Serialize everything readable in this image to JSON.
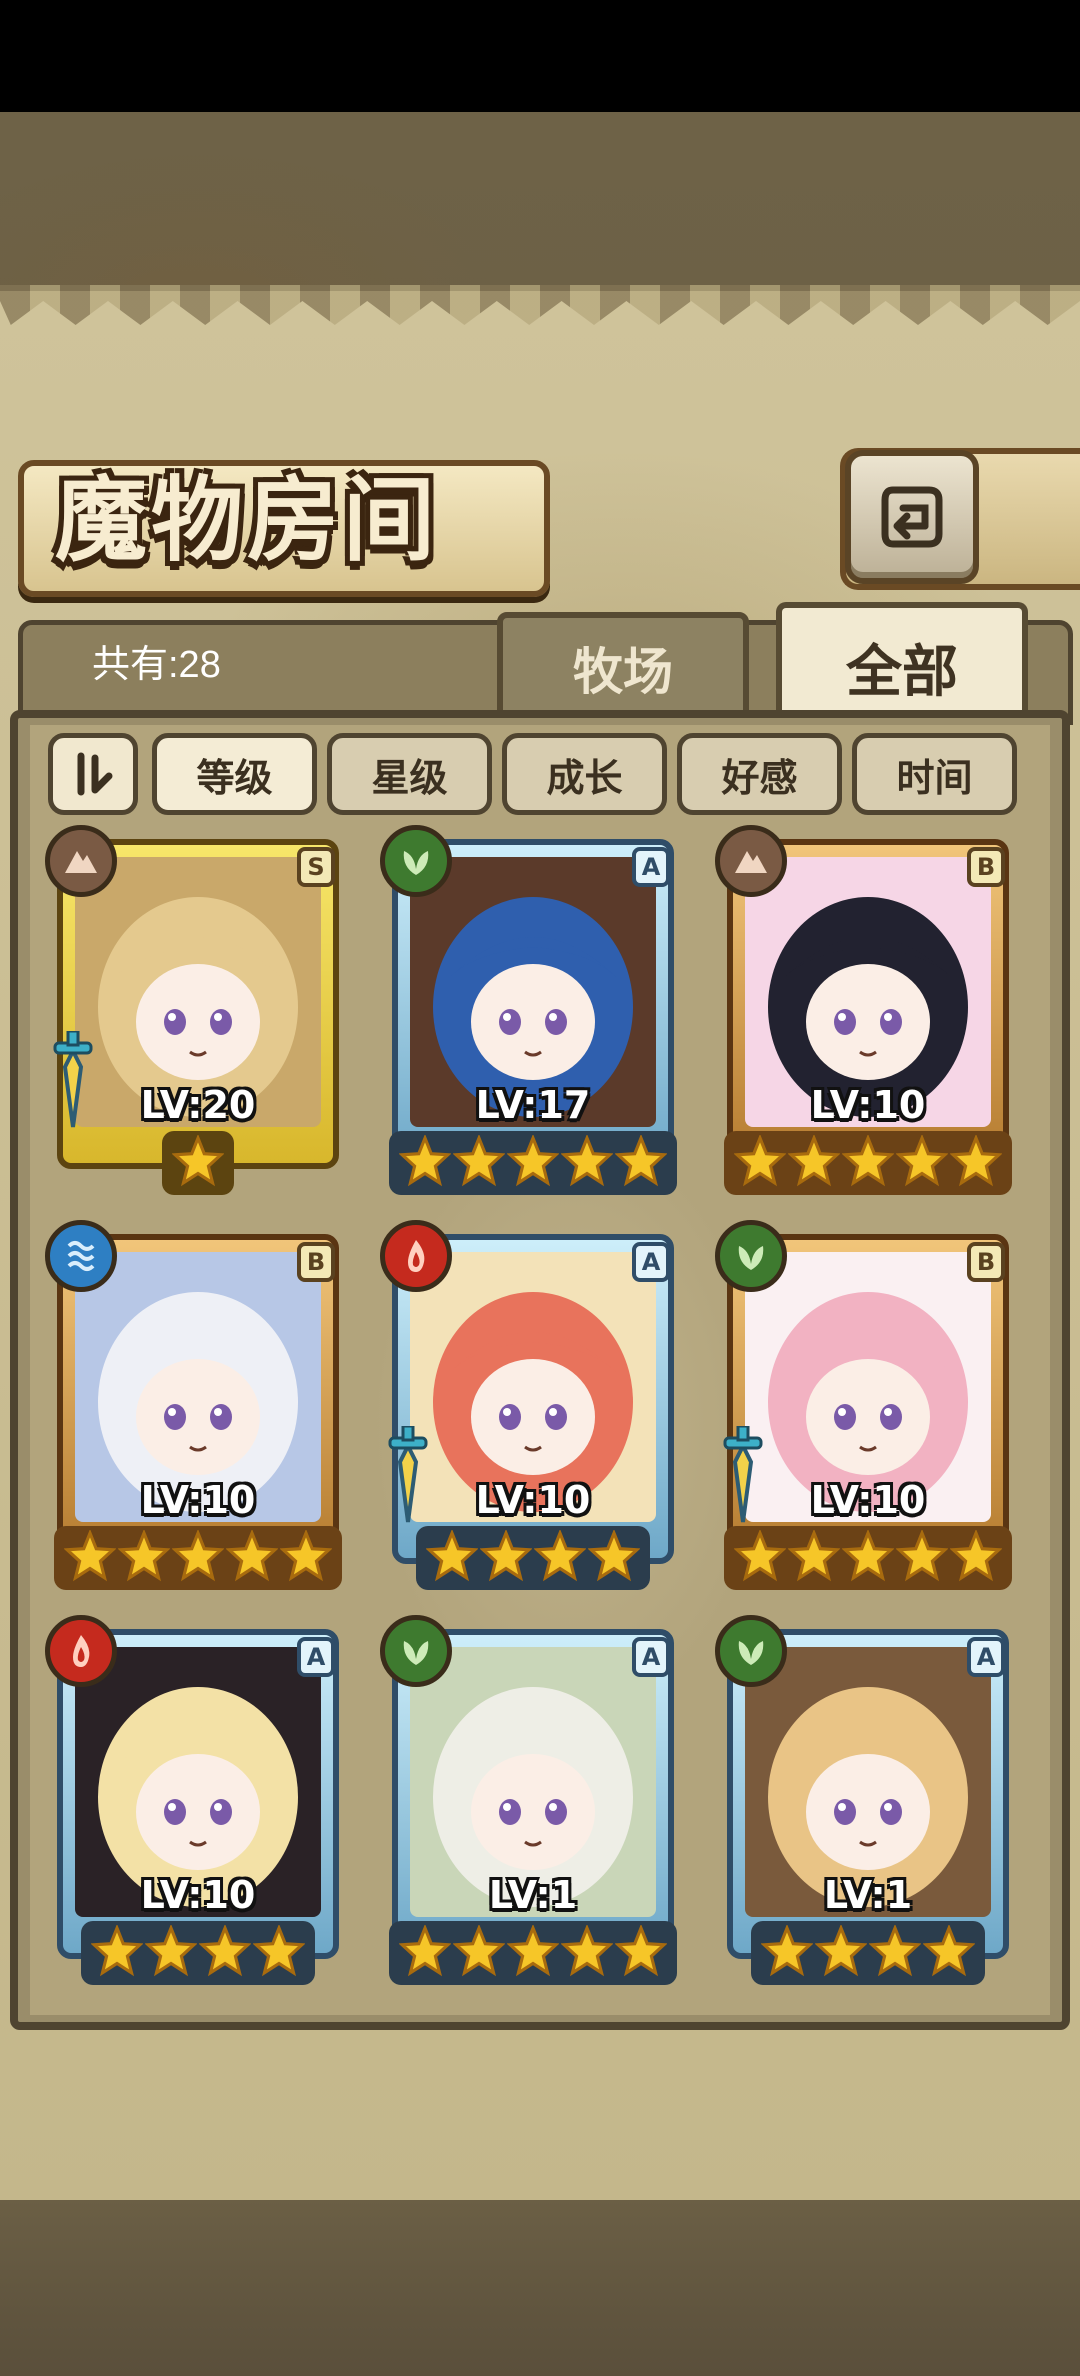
{
  "header": {
    "title": "魔物房间"
  },
  "summary": {
    "count_text": "共有:28"
  },
  "tabs": [
    {
      "label": "牧场",
      "active": false
    },
    {
      "label": "全部",
      "active": true
    }
  ],
  "sort": {
    "toggle_icon": "sort-order-icon",
    "options": [
      {
        "label": "等级",
        "active": true
      },
      {
        "label": "星级",
        "active": false
      },
      {
        "label": "成长",
        "active": false
      },
      {
        "label": "好感",
        "active": false
      },
      {
        "label": "时间",
        "active": false
      }
    ]
  },
  "monsters": [
    {
      "rank": "S",
      "level": "LV:20",
      "stars": 1,
      "element": "earth",
      "equipped": true,
      "colors": [
        "#e4c98e",
        "#c9a86a"
      ]
    },
    {
      "rank": "A",
      "level": "LV:17",
      "stars": 5,
      "element": "wood",
      "equipped": false,
      "colors": [
        "#2f5fae",
        "#5b3a2a"
      ]
    },
    {
      "rank": "B",
      "level": "LV:10",
      "stars": 5,
      "element": "earth",
      "equipped": false,
      "colors": [
        "#222230",
        "#f6d6e6"
      ]
    },
    {
      "rank": "B",
      "level": "LV:10",
      "stars": 5,
      "element": "water",
      "equipped": false,
      "colors": [
        "#eef0f6",
        "#b7c7e6"
      ]
    },
    {
      "rank": "A",
      "level": "LV:10",
      "stars": 4,
      "element": "fire",
      "equipped": true,
      "colors": [
        "#e8735c",
        "#f3e2b8"
      ]
    },
    {
      "rank": "B",
      "level": "LV:10",
      "stars": 5,
      "element": "wood",
      "equipped": true,
      "colors": [
        "#f2b2c2",
        "#faf0f2"
      ]
    },
    {
      "rank": "A",
      "level": "LV:10",
      "stars": 4,
      "element": "fire",
      "equipped": false,
      "colors": [
        "#f3e1a6",
        "#2a2226"
      ]
    },
    {
      "rank": "A",
      "level": "LV:1",
      "stars": 5,
      "element": "wood",
      "equipped": false,
      "colors": [
        "#eeeee6",
        "#c9d6b8"
      ]
    },
    {
      "rank": "A",
      "level": "LV:1",
      "stars": 4,
      "element": "wood",
      "equipped": false,
      "colors": [
        "#e9c486",
        "#7a5a3c"
      ]
    }
  ],
  "colors": {
    "parchment": "#cfc39a",
    "frame_dark": "#4f4430",
    "star_gold": "#f6c628"
  }
}
